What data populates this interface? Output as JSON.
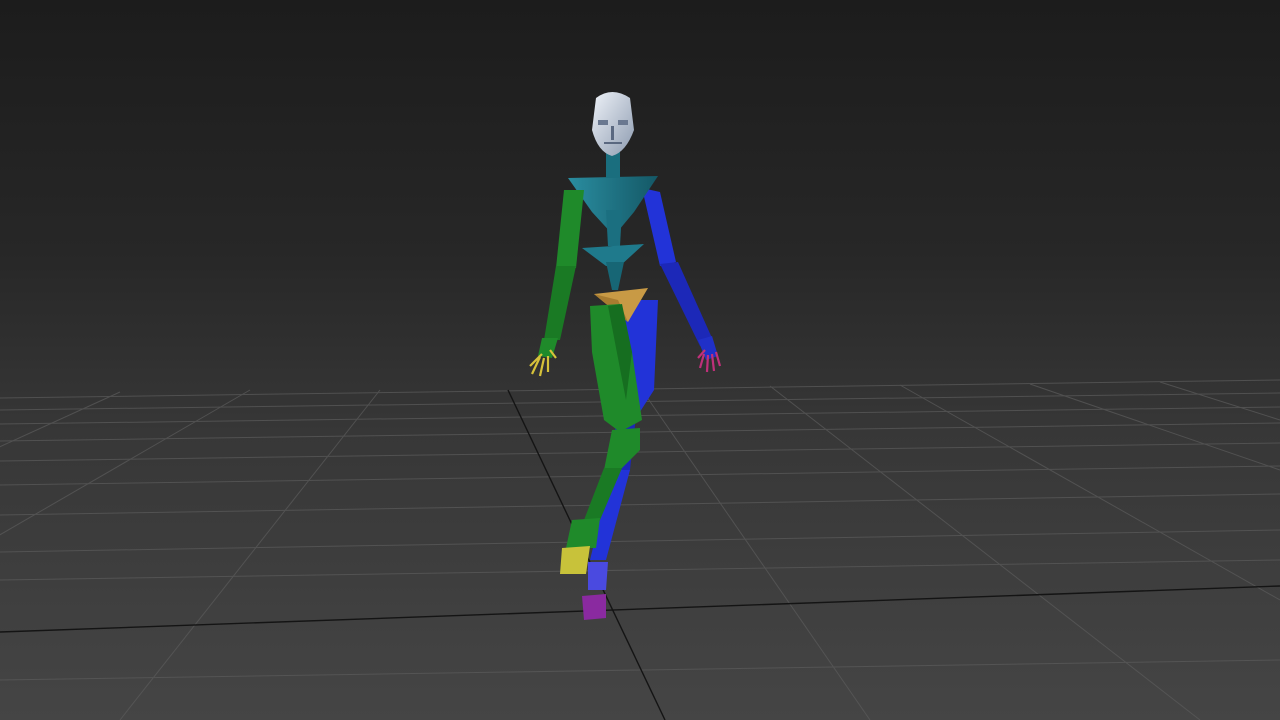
{
  "viewport": {
    "view": "perspective",
    "display_mode": "shaded",
    "grid_visible": true,
    "background_top": "#1c1c1c",
    "background_bottom": "#454545"
  },
  "scene": {
    "rig_type": "biped",
    "pose": "walking",
    "colors": {
      "head": "#c9d4e3",
      "spine": "#1f7a8c",
      "left_limbs": "#1f8a2a",
      "right_limbs": "#1f2fd6",
      "pelvis": "#c89a45",
      "left_fingers": "#d6c23a",
      "right_fingers": "#c0307a",
      "left_foot": "#c8c23a",
      "right_foot": "#8a2aa0",
      "grid_line": "#5a5a5a",
      "grid_axis": "#111111"
    }
  }
}
